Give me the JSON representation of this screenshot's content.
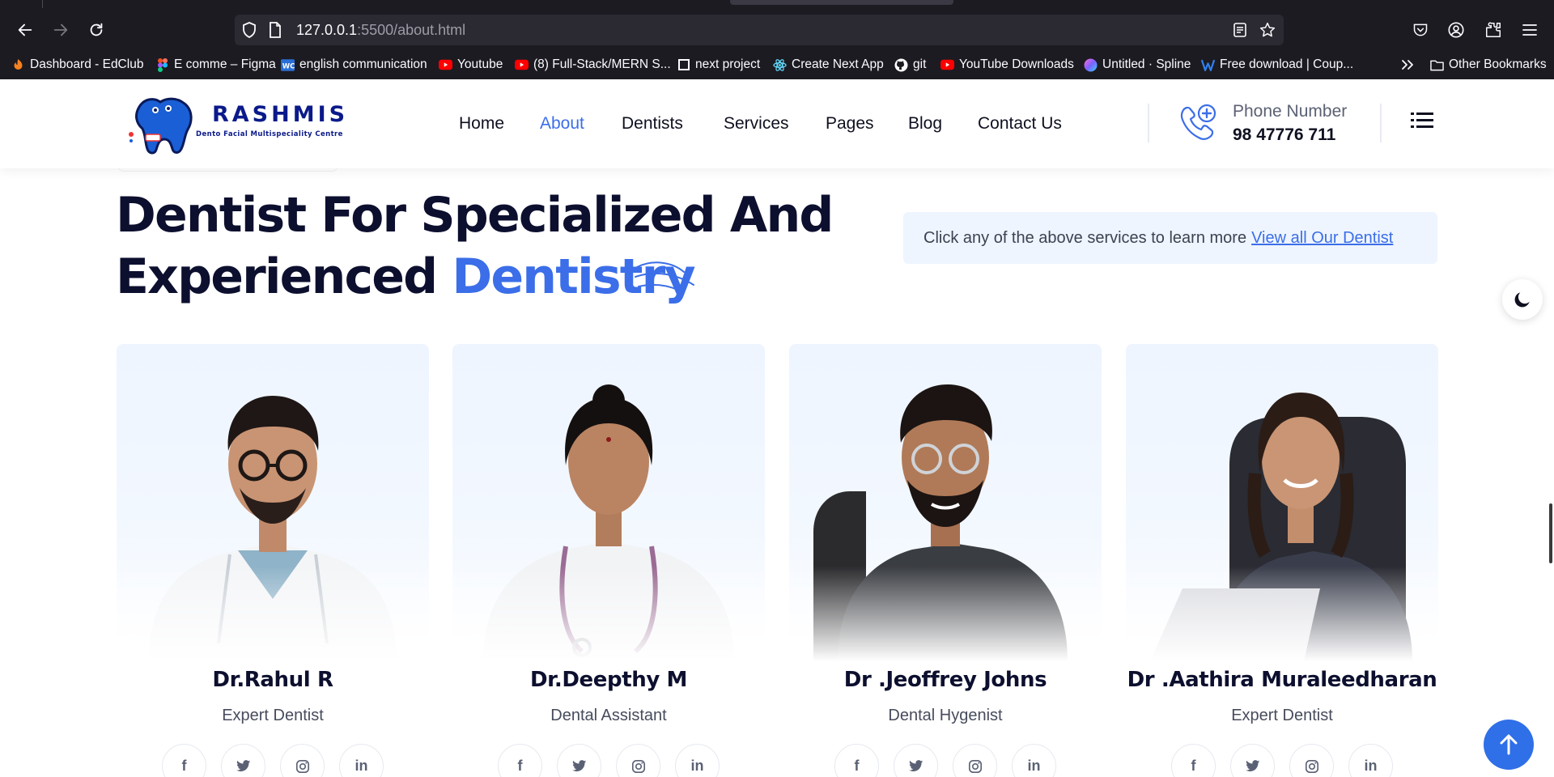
{
  "browser": {
    "url_host": "127.0.0.1",
    "url_path": ":5500/about.html",
    "bookmarks": [
      {
        "label": "Dashboard - EdClub",
        "icon": "edclub-icon",
        "color": "#f5821f"
      },
      {
        "label": "E comme – Figma",
        "icon": "figma-icon",
        "color": "#a259ff"
      },
      {
        "label": "english communication",
        "icon": "wc-icon",
        "color": "#2a6fd6"
      },
      {
        "label": "Youtube",
        "icon": "youtube-icon",
        "color": "#ff0000"
      },
      {
        "label": "(8) Full-Stack/MERN S...",
        "icon": "youtube-icon",
        "color": "#ff0000"
      },
      {
        "label": "next project",
        "icon": "notion-icon",
        "color": "#ffffff"
      },
      {
        "label": "Create Next App",
        "icon": "react-icon",
        "color": "#61dafb"
      },
      {
        "label": "git",
        "icon": "github-icon",
        "color": "#ffffff"
      },
      {
        "label": "YouTube Downloads",
        "icon": "youtube-icon",
        "color": "#ff0000"
      },
      {
        "label": "Untitled · Spline",
        "icon": "spline-icon",
        "color": "#7b61ff"
      },
      {
        "label": "Free download | Coup...",
        "icon": "coupon-icon",
        "color": "#2f80ed"
      }
    ],
    "other_bookmarks": "Other Bookmarks"
  },
  "header": {
    "logo_title": "RASHMIS",
    "logo_subtitle": "Dento Facial Multispeciality Centre",
    "nav": [
      "Home",
      "About",
      "Dentists",
      "Services",
      "Pages",
      "Blog",
      "Contact Us"
    ],
    "active_nav": "About",
    "phone_label": "Phone Number",
    "phone_number": "98 47776 711"
  },
  "hero": {
    "headline_line1": "Dentist For Specialized And",
    "headline_line2": "Experienced",
    "headline_accent": "Dentistry",
    "info_text": "Click any of the above services to learn more",
    "info_link": "View all Our Dentist"
  },
  "dentists": [
    {
      "name": "Dr.Rahul R",
      "role": "Expert Dentist"
    },
    {
      "name": "Dr.Deepthy M",
      "role": "Dental Assistant"
    },
    {
      "name": "Dr .Jeoffrey Johns",
      "role": "Dental Hygenist"
    },
    {
      "name": "Dr .Aathira Muraleedharan",
      "role": "Expert Dentist"
    }
  ],
  "socials": [
    "facebook-icon",
    "twitter-icon",
    "instagram-icon",
    "linkedin-icon"
  ],
  "colors": {
    "accent": "#3b6ee8",
    "heading": "#0c0f2e",
    "chrome_bg": "#1c1b22"
  }
}
